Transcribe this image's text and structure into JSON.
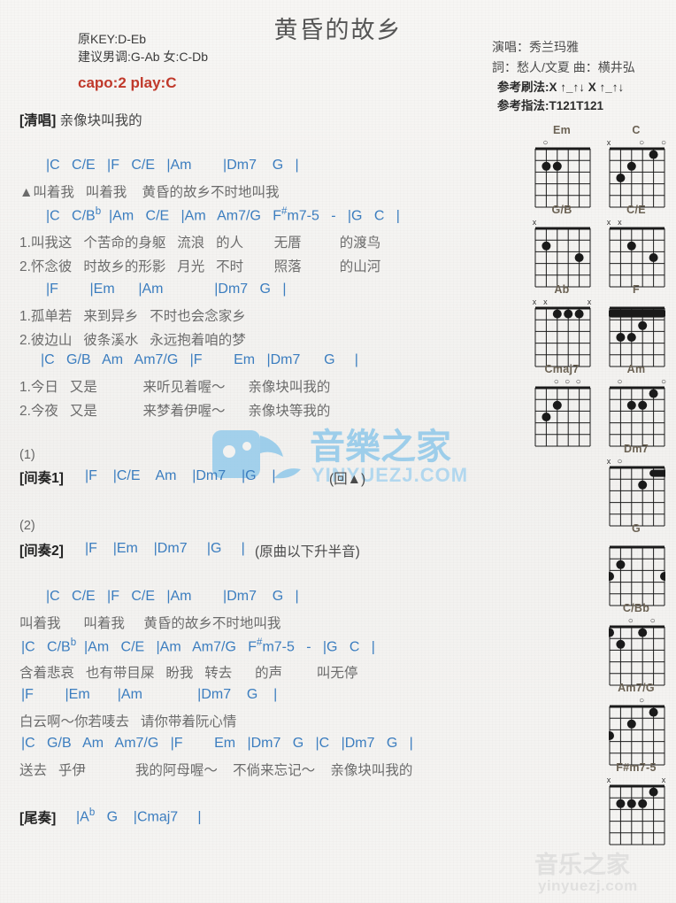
{
  "header": {
    "title": "黄昏的故乡",
    "key_line": "原KEY:D-Eb",
    "suggest_line": "建议男调:G-Ab 女:C-Db",
    "capo": "capo:2 play:C",
    "singer": "演唱：秀兰玛雅",
    "writers": "詞：愁人/文夏   曲：横井弘",
    "strum": "参考刷法:X ↑_↑↓ X ↑_↑↓",
    "fingering": "参考指法:T121T121"
  },
  "sections": {
    "intro_tag": "[清唱]",
    "intro_lyric": "亲像块叫我的",
    "mark1": "(1)",
    "interlude1_tag": "[间奏1]",
    "interlude1_note": "(回▲)",
    "mark2": "(2)",
    "interlude2_tag": "[间奏2]",
    "interlude2_note": "(原曲以下升半音)",
    "outro_tag": "[尾奏]"
  },
  "lines": {
    "c1": "|C   C/E   |F   C/E   |Am        |Dm7    G   |",
    "l1": "▲叫着我   叫着我    黄昏的故乡不时地叫我",
    "c2_a": "|C   C/B",
    "c2_b": "  |Am   C/E   |Am   Am7/G   F",
    "c2_c": "m7-5   -   |G   C   |",
    "l2": "1.叫我这   个苦命的身躯   流浪   的人        无厝          的渡鸟",
    "l3": "2.怀念彼   时故乡的形影   月光   不时        照落          的山河",
    "c3": "|F        |Em      |Am             |Dm7   G   |",
    "l4": "1.孤单若   来到异乡   不时也会念家乡",
    "l5": "2.彼边山   彼条溪水   永远抱着咱的梦",
    "c4": "|C   G/B   Am   Am7/G   |F        Em   |Dm7      G     |",
    "l6": "1.今日   又是            来听见着喔～      亲像块叫我的",
    "l7": "2.今夜   又是            来梦着伊喔～      亲像块等我的",
    "i1": "|F    |C/E    Am    |Dm7    |G    |",
    "i2": "|F    |Em    |Dm7     |G     |",
    "c5": "|C   C/E   |F   C/E   |Am        |Dm7    G   |",
    "l8": "叫着我      叫着我     黄昏的故乡不时地叫我",
    "c6_a": "|C   C/B",
    "c6_b": "  |Am   C/E   |Am   Am7/G   F",
    "c6_c": "m7-5   -   |G   C   |",
    "l9": "含着悲哀   也有带目屎   盼我   转去      的声         叫无停",
    "c7": "|F        |Em       |Am              |Dm7    G    |",
    "l10": "白云啊～你若唛去   请你带着阮心情",
    "c8": "|C   G/B   Am   Am7/G   |F        Em   |Dm7   G   |C   |Dm7   G   |",
    "l11": "送去   乎伊             我的阿母喔～    不倘来忘记～    亲像块叫我的",
    "outro_a": "|A",
    "outro_b": "   G    |Cmaj7     |"
  },
  "watermark": {
    "center_text": "音樂之家",
    "center_sub": "YINYUEZJ.COM",
    "bottom_text": "音乐之家",
    "bottom_sub": "yinyuezj.com",
    "color": "#8fc8ea"
  },
  "chord_diagrams": [
    {
      "name": "Em",
      "markers": [
        "",
        "o",
        "",
        "",
        "",
        ""
      ],
      "dots": [
        {
          "s": 5,
          "f": 2
        },
        {
          "s": 4,
          "f": 2
        }
      ],
      "barres": []
    },
    {
      "name": "C",
      "markers": [
        "x",
        "",
        "",
        "o",
        "",
        "o"
      ],
      "dots": [
        {
          "s": 5,
          "f": 3
        },
        {
          "s": 4,
          "f": 2
        },
        {
          "s": 2,
          "f": 1
        }
      ],
      "barres": []
    },
    {
      "name": "G/B",
      "markers": [
        "x",
        "",
        "",
        "",
        "",
        ""
      ],
      "dots": [
        {
          "s": 5,
          "f": 2
        },
        {
          "s": 2,
          "f": 3
        }
      ],
      "barres": []
    },
    {
      "name": "C/E",
      "markers": [
        "x",
        "x",
        "",
        "",
        "",
        ""
      ],
      "dots": [
        {
          "s": 4,
          "f": 2
        },
        {
          "s": 2,
          "f": 3
        }
      ],
      "barres": []
    },
    {
      "name": "Ab",
      "markers": [
        "x",
        "x",
        "",
        "",
        "",
        "x"
      ],
      "dots": [
        {
          "s": 4,
          "f": 1
        },
        {
          "s": 3,
          "f": 1
        },
        {
          "s": 2,
          "f": 1
        }
      ],
      "barres": []
    },
    {
      "name": "F",
      "markers": [
        "",
        "",
        "",
        "",
        "",
        ""
      ],
      "dots": [
        {
          "s": 5,
          "f": 3
        },
        {
          "s": 4,
          "f": 3
        },
        {
          "s": 3,
          "f": 2
        }
      ],
      "barres": [
        {
          "f": 1,
          "from": 6,
          "to": 1
        }
      ]
    },
    {
      "name": "Cmaj7",
      "markers": [
        "",
        "",
        "o",
        "o",
        "o",
        ""
      ],
      "dots": [
        {
          "s": 5,
          "f": 3
        },
        {
          "s": 4,
          "f": 2
        }
      ],
      "barres": []
    },
    {
      "name": "Am",
      "markers": [
        "",
        "o",
        "",
        "",
        "",
        "o"
      ],
      "dots": [
        {
          "s": 4,
          "f": 2
        },
        {
          "s": 3,
          "f": 2
        },
        {
          "s": 2,
          "f": 1
        }
      ],
      "barres": []
    },
    {
      "name": "Dm7",
      "markers": [
        "x",
        "o",
        "",
        "",
        "",
        ""
      ],
      "dots": [
        {
          "s": 3,
          "f": 2
        }
      ],
      "barres": [
        {
          "f": 1,
          "from": 2,
          "to": 1
        }
      ]
    },
    {
      "name": "G",
      "markers": [
        "",
        "",
        "",
        "",
        "",
        ""
      ],
      "dots": [
        {
          "s": 6,
          "f": 3
        },
        {
          "s": 5,
          "f": 2
        },
        {
          "s": 1,
          "f": 3
        }
      ],
      "barres": []
    },
    {
      "name": "C/Bb",
      "markers": [
        "",
        "",
        "o",
        "",
        "o",
        ""
      ],
      "dots": [
        {
          "s": 6,
          "f": 1
        },
        {
          "s": 5,
          "f": 2
        },
        {
          "s": 3,
          "f": 1
        }
      ],
      "barres": []
    },
    {
      "name": "Am7/G",
      "markers": [
        "",
        "",
        "",
        "o",
        "",
        ""
      ],
      "dots": [
        {
          "s": 6,
          "f": 3
        },
        {
          "s": 4,
          "f": 2
        },
        {
          "s": 2,
          "f": 1
        }
      ],
      "barres": []
    },
    {
      "name": "F#m7-5",
      "markers": [
        "x",
        "",
        "",
        "",
        "",
        "x"
      ],
      "dots": [
        {
          "s": 5,
          "f": 2
        },
        {
          "s": 4,
          "f": 2
        },
        {
          "s": 3,
          "f": 2
        },
        {
          "s": 2,
          "f": 1
        }
      ],
      "barres": []
    }
  ]
}
